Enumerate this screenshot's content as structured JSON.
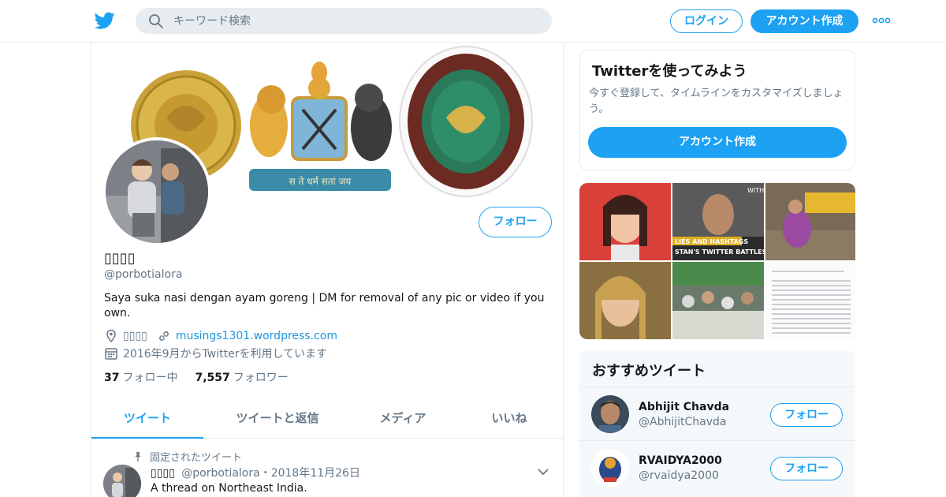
{
  "header": {
    "logo": "twitter-bird-icon",
    "search": {
      "placeholder": "キーワード検索",
      "value": "",
      "icon": "search-icon"
    },
    "login_label": "ログイン",
    "signup_label": "アカウント作成",
    "more_icon": "more-dots-icon"
  },
  "colors": {
    "accent": "#1da1f2",
    "link": "#1b95e0",
    "muted": "#657786",
    "text": "#14171a",
    "border": "#e6ecf0",
    "panel": "#f5f8fa"
  },
  "profile": {
    "name": "▯▯▯▯",
    "handle": "@porbotialora",
    "follow_label": "フォロー",
    "bio": "Saya suka nasi dengan ayam goreng | DM for removal of any pic or video if you own.",
    "location": "▯▯▯▯",
    "website": "musings1301.wordpress.com",
    "joined": "2016年9月からTwitterを利用しています",
    "stats": {
      "following_count": "37",
      "following_label": "フォロー中",
      "followers_count": "7,557",
      "followers_label": "フォロワー"
    },
    "banner_motto": "स ते धर्म सतां जय"
  },
  "tabs": [
    {
      "label": "ツイート",
      "active": true
    },
    {
      "label": "ツイートと返信",
      "active": false
    },
    {
      "label": "メディア",
      "active": false
    },
    {
      "label": "いいね",
      "active": false
    }
  ],
  "tweet": {
    "pinned_label": "固定されたツイート",
    "name": "▯▯▯▯",
    "handle": "@porbotialora",
    "separator": "・",
    "date": "2018年11月26日",
    "text": "A thread on Northeast India."
  },
  "signup_card": {
    "title": "Twitterを使ってみよう",
    "text": "今すぐ登録して、タイムラインをカスタマイズしましょう。",
    "button_label": "アカウント作成"
  },
  "media_grid": {
    "caption_1": "LIES AND HASHTAGS",
    "caption_2": "STAN'S TWITTER BATTLES",
    "badge": "WITH"
  },
  "recommendations": {
    "title": "おすすめツイート",
    "items": [
      {
        "name": "Abhijit Chavda",
        "handle": "@AbhijitChavda",
        "follow_label": "フォロー"
      },
      {
        "name": "RVAIDYA2000",
        "handle": "@rvaidya2000",
        "follow_label": "フォロー"
      }
    ]
  }
}
